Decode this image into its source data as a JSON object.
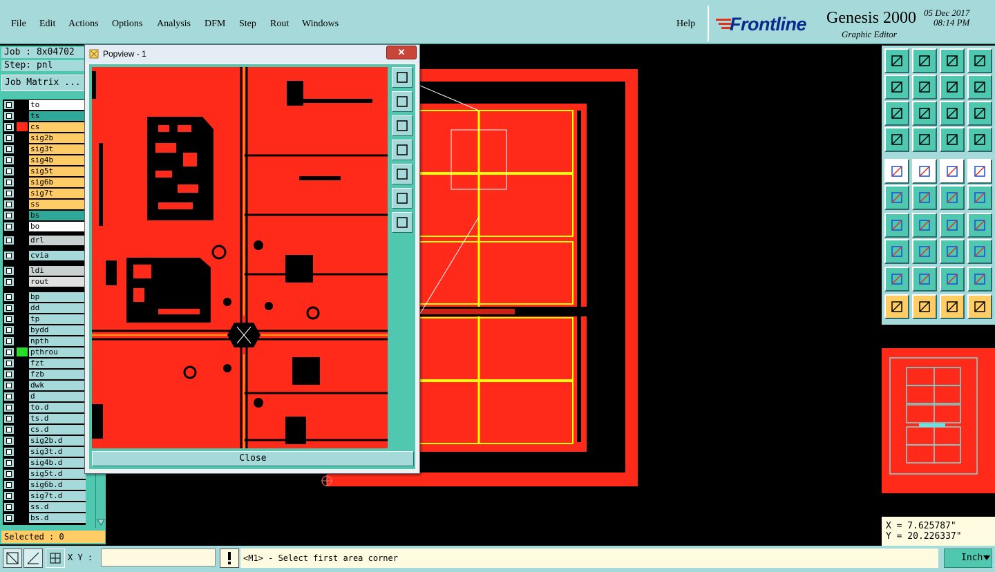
{
  "menu": {
    "items": [
      {
        "id": "file",
        "label": "File"
      },
      {
        "id": "edit",
        "label": "Edit"
      },
      {
        "id": "actions",
        "label": "Actions"
      },
      {
        "id": "options",
        "label": "Options"
      },
      {
        "id": "analysis",
        "label": "Analysis"
      },
      {
        "id": "dfm",
        "label": "DFM"
      },
      {
        "id": "step",
        "label": "Step"
      },
      {
        "id": "rout",
        "label": "Rout"
      },
      {
        "id": "windows",
        "label": "Windows"
      }
    ],
    "help": "Help"
  },
  "brand": {
    "logo": "Frontline",
    "product": "Genesis 2000",
    "subtitle": "Graphic Editor",
    "date": "05 Dec 2017",
    "time": "08:14 PM"
  },
  "left_panel": {
    "job": "Job : 8x04702",
    "step": "Step: pnl",
    "job_matrix": "Job Matrix ..."
  },
  "layers": [
    {
      "name": "to",
      "color": "#ffffff",
      "swatch": "#000000"
    },
    {
      "name": "ts",
      "color": "#2fa89a",
      "swatch": "#000000"
    },
    {
      "name": "cs",
      "color": "#ffcc66",
      "swatch": "#ff2a1a"
    },
    {
      "name": "sig2b",
      "color": "#ffcc66",
      "swatch": "#000000"
    },
    {
      "name": "sig3t",
      "color": "#ffcc66",
      "swatch": "#000000"
    },
    {
      "name": "sig4b",
      "color": "#ffcc66",
      "swatch": "#000000"
    },
    {
      "name": "sig5t",
      "color": "#ffcc66",
      "swatch": "#000000"
    },
    {
      "name": "sig6b",
      "color": "#ffcc66",
      "swatch": "#000000"
    },
    {
      "name": "sig7t",
      "color": "#ffcc66",
      "swatch": "#000000"
    },
    {
      "name": "ss",
      "color": "#ffcc66",
      "swatch": "#000000"
    },
    {
      "name": "bs",
      "color": "#2fa89a",
      "swatch": "#000000"
    },
    {
      "name": "bo",
      "color": "#ffffff",
      "swatch": "#000000"
    },
    {
      "name": "drl",
      "color": "#c8d0d0",
      "swatch": "#000000"
    },
    {
      "name": "cvia",
      "color": "#a6d9d9",
      "swatch": "#000000"
    },
    {
      "name": "ldi",
      "color": "#c8d0d0",
      "swatch": "#000000"
    },
    {
      "name": "rout",
      "color": "#e0e0e0",
      "swatch": "#000000"
    },
    {
      "name": "bp",
      "color": "#a6d9d9",
      "swatch": "#000000"
    },
    {
      "name": "dd",
      "color": "#a6d9d9",
      "swatch": "#000000"
    },
    {
      "name": "tp",
      "color": "#a6d9d9",
      "swatch": "#000000"
    },
    {
      "name": "bydd",
      "color": "#a6d9d9",
      "swatch": "#000000"
    },
    {
      "name": "npth",
      "color": "#a6d9d9",
      "swatch": "#000000"
    },
    {
      "name": "pthrou",
      "color": "#a6d9d9",
      "swatch": "#2adc2a"
    },
    {
      "name": "fzt",
      "color": "#a6d9d9",
      "swatch": "#000000"
    },
    {
      "name": "fzb",
      "color": "#a6d9d9",
      "swatch": "#000000"
    },
    {
      "name": "dwk",
      "color": "#a6d9d9",
      "swatch": "#000000"
    },
    {
      "name": "d",
      "color": "#a6d9d9",
      "swatch": "#000000"
    },
    {
      "name": "to.d",
      "color": "#a6d9d9",
      "swatch": "#000000"
    },
    {
      "name": "ts.d",
      "color": "#a6d9d9",
      "swatch": "#000000"
    },
    {
      "name": "cs.d",
      "color": "#a6d9d9",
      "swatch": "#000000"
    },
    {
      "name": "sig2b.d",
      "color": "#a6d9d9",
      "swatch": "#000000"
    },
    {
      "name": "sig3t.d",
      "color": "#a6d9d9",
      "swatch": "#000000"
    },
    {
      "name": "sig4b.d",
      "color": "#a6d9d9",
      "swatch": "#000000"
    },
    {
      "name": "sig5t.d",
      "color": "#a6d9d9",
      "swatch": "#000000"
    },
    {
      "name": "sig6b.d",
      "color": "#a6d9d9",
      "swatch": "#000000"
    },
    {
      "name": "sig7t.d",
      "color": "#a6d9d9",
      "swatch": "#000000"
    },
    {
      "name": "ss.d",
      "color": "#a6d9d9",
      "swatch": "#000000"
    },
    {
      "name": "bs.d",
      "color": "#a6d9d9",
      "swatch": "#000000"
    }
  ],
  "selected": "Selected : 0",
  "popview": {
    "title": "Popview - 1",
    "close_x": "✕",
    "close_button": "Close"
  },
  "status": {
    "xy_label": "X Y :",
    "xy_value": "",
    "message": "<M1> - Select first area corner",
    "units": "Inch"
  },
  "coords": {
    "x": "X = 7.625787\"",
    "y": "Y = 20.226337\""
  },
  "colors": {
    "canvas_bg": "#000000",
    "copper": "#ff2a1a",
    "highlight": "#ffff00",
    "panel": "#a6d9d9",
    "accent": "#50c8b0"
  }
}
